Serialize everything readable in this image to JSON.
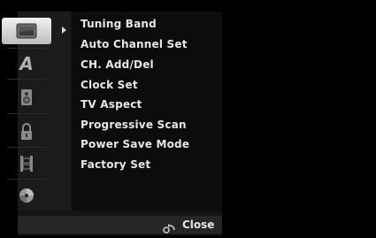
{
  "sidebar": {
    "items": [
      {
        "icon": "tv-screen-icon",
        "active": true
      },
      {
        "icon": "letter-a-icon",
        "active": false
      },
      {
        "icon": "speaker-icon",
        "active": false
      },
      {
        "icon": "padlock-icon",
        "active": false
      },
      {
        "icon": "film-strip-icon",
        "active": false
      },
      {
        "icon": "disc-icon",
        "active": false
      }
    ]
  },
  "menu": {
    "items": [
      {
        "label": "Tuning Band"
      },
      {
        "label": "Auto Channel Set"
      },
      {
        "label": "CH. Add/Del"
      },
      {
        "label": "Clock Set"
      },
      {
        "label": "TV Aspect"
      },
      {
        "label": "Progressive Scan"
      },
      {
        "label": "Power Save Mode"
      },
      {
        "label": "Factory Set"
      }
    ]
  },
  "footer": {
    "close_label": "Close",
    "icon": "return-icon"
  }
}
